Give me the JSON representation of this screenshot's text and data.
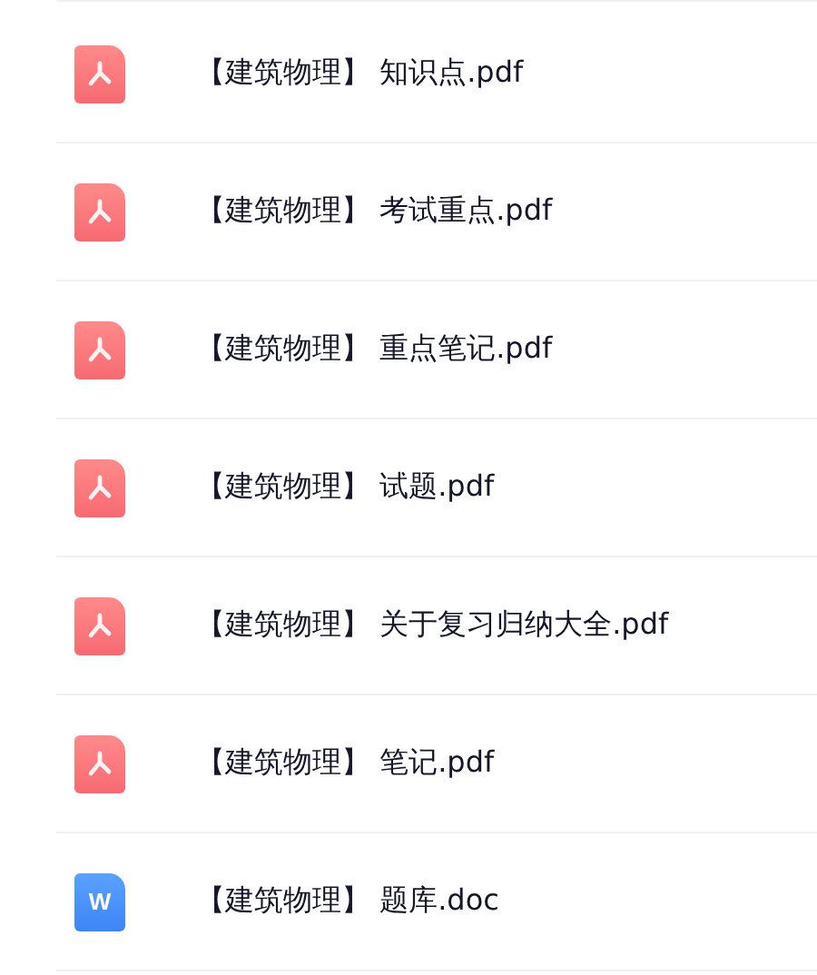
{
  "files": [
    {
      "kind": "pdf",
      "name": "【建筑物理】 知识点.pdf"
    },
    {
      "kind": "pdf",
      "name": "【建筑物理】 考试重点.pdf"
    },
    {
      "kind": "pdf",
      "name": "【建筑物理】 重点笔记.pdf"
    },
    {
      "kind": "pdf",
      "name": "【建筑物理】 试题.pdf"
    },
    {
      "kind": "pdf",
      "name": "【建筑物理】 关于复习归纳大全.pdf"
    },
    {
      "kind": "pdf",
      "name": "【建筑物理】 笔记.pdf"
    },
    {
      "kind": "doc",
      "name": "【建筑物理】 题库.doc",
      "badge": "W"
    }
  ]
}
